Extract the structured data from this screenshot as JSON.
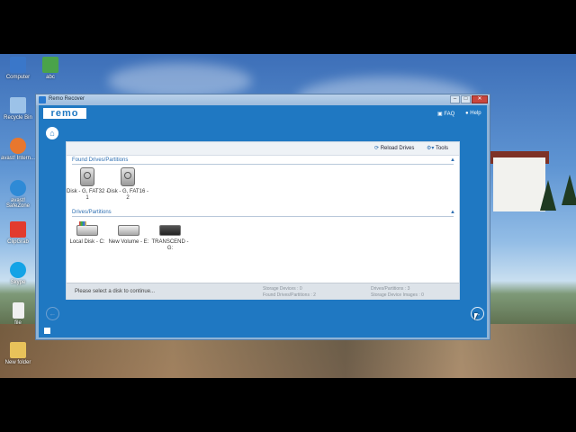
{
  "desktop": {
    "icons": [
      {
        "label": "Computer",
        "icon": "computer-icon",
        "color": "#3a77c9"
      },
      {
        "label": "abc",
        "icon": "document-icon",
        "color": "#4aa34a"
      },
      {
        "label": "Recycle Bin",
        "icon": "recycle-bin-icon",
        "color": "#9cc2e8"
      },
      {
        "label": "avast! Intern...",
        "icon": "avast-icon",
        "color": "#e8772e"
      },
      {
        "label": "avast! SafeZone",
        "icon": "safezone-icon",
        "color": "#2e8ad6"
      },
      {
        "label": "ClipGrab",
        "icon": "clipgrab-icon",
        "color": "#e23b2e"
      },
      {
        "label": "Skype",
        "icon": "skype-icon",
        "color": "#14a3e6"
      },
      {
        "label": "file",
        "icon": "file-icon",
        "color": "#f0f0f0"
      },
      {
        "label": "New folder",
        "icon": "folder-icon",
        "color": "#e8c25a"
      }
    ]
  },
  "window": {
    "title": "Remo Recover",
    "minimize": "–",
    "maximize": "□",
    "close": "✕"
  },
  "app": {
    "logo": "remo",
    "faq_label": "FAQ",
    "help_label": "Help",
    "home_glyph": "⌂",
    "toolbar": {
      "reload_label": "Reload Drives",
      "tools_label": "Tools"
    },
    "found_section": {
      "title": "Found Drives/Partitions",
      "collapse_glyph": "▲",
      "items": [
        {
          "label": "Disk - G, FAT32 - 1"
        },
        {
          "label": "Disk - G, FAT16 - 2"
        }
      ]
    },
    "drives_section": {
      "title": "Drives/Partitions",
      "collapse_glyph": "▲",
      "items": [
        {
          "label": "Local Disk - C:",
          "icon": "local-disk-icon"
        },
        {
          "label": "New Volume - E:",
          "icon": "hard-drive-icon"
        },
        {
          "label": "TRANSCEND - G:",
          "icon": "usb-drive-icon"
        }
      ]
    },
    "status": {
      "message": "Please select a disk to continue...",
      "storage_devices": "Storage Devices : 0",
      "found_partitions": "Found Drives/Partitions : 2",
      "drives_partitions": "Drives/Partitions : 3",
      "storage_images": "Storage Device Images : 0"
    },
    "nav": {
      "back_glyph": "←",
      "next_glyph": "→"
    }
  }
}
